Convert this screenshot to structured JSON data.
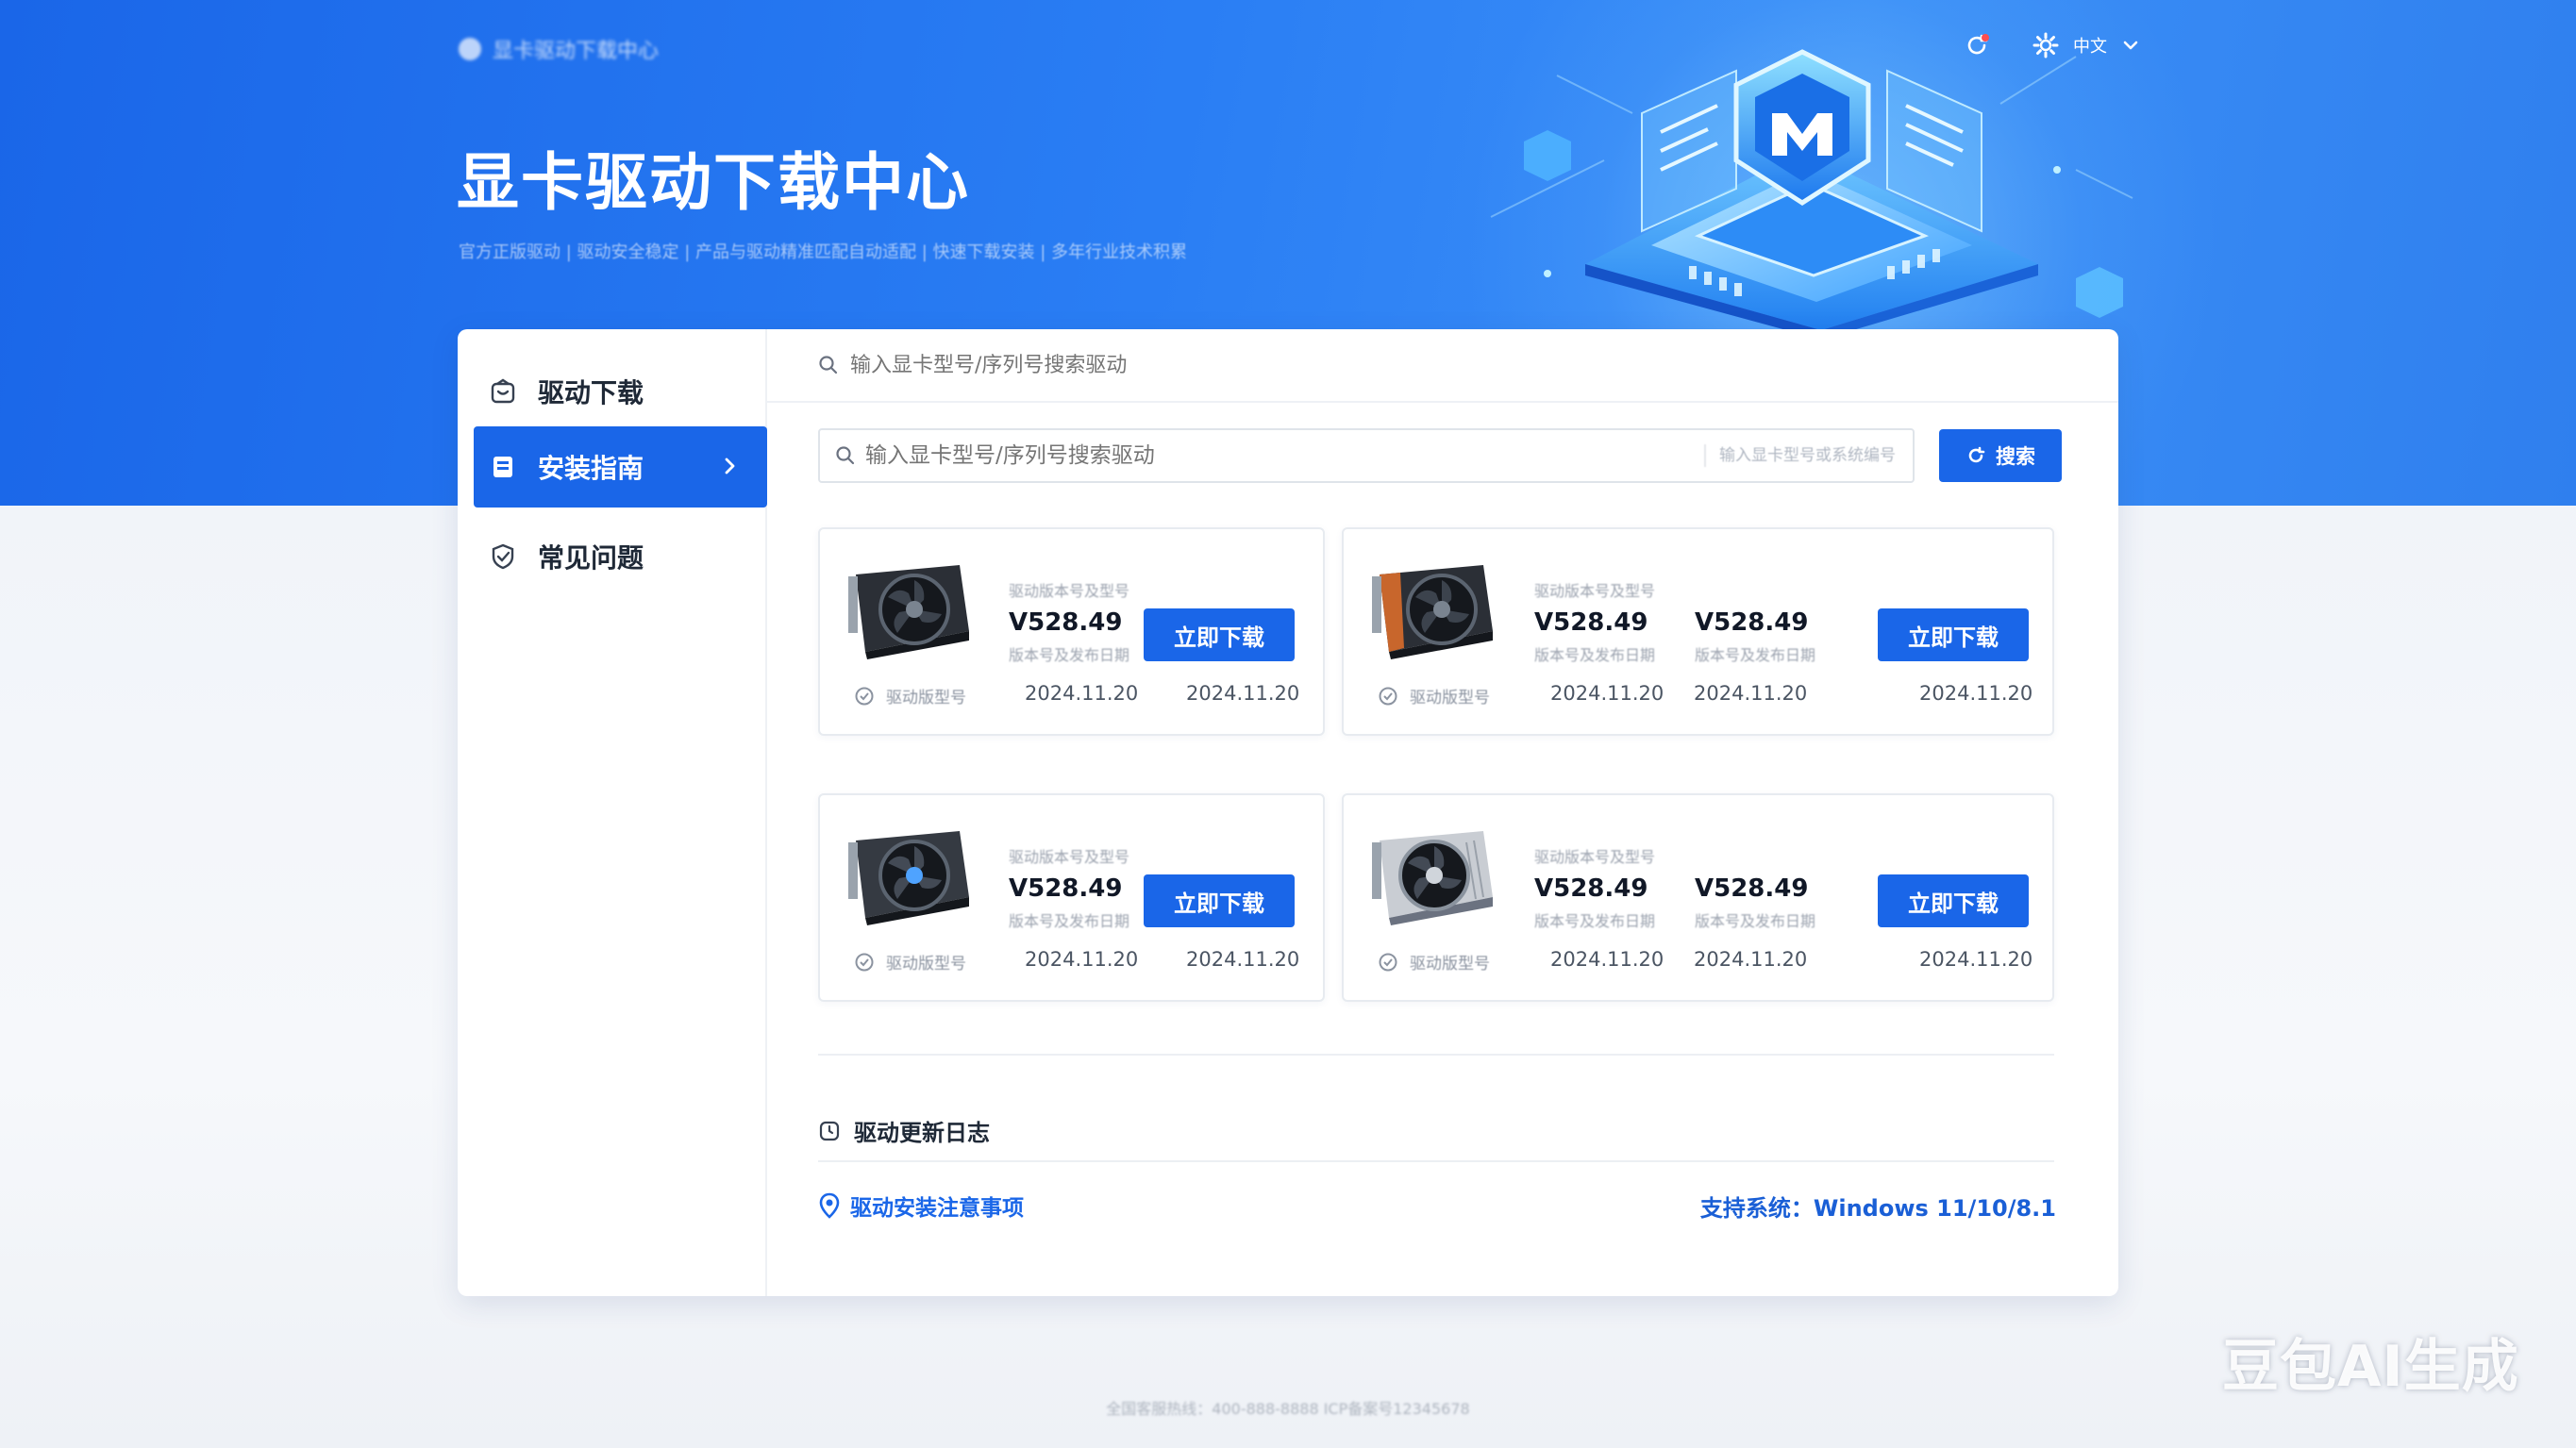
{
  "header": {
    "brand": "显卡驱动下载中心",
    "title": "显卡驱动下载中心",
    "subtitle": "官方正版驱动  |  驱动安全稳定  |  产品与驱动精准匹配自动适配  |  快速下载安装  |  多年行业技术积累",
    "language_label": "中文"
  },
  "sidebar": {
    "items": [
      {
        "label": "驱动下载",
        "icon": "box-icon"
      },
      {
        "label": "安装指南",
        "icon": "book-icon",
        "active": true
      },
      {
        "label": "常见问题",
        "icon": "shield-check-icon"
      }
    ]
  },
  "search": {
    "top_placeholder": "输入显卡型号/序列号搜索驱动",
    "main_placeholder": "输入显卡型号/序列号搜索驱动",
    "hint": "输入显卡型号或系统编号",
    "button_label": "搜索"
  },
  "cards": [
    {
      "label_top": "驱动版本号及型号",
      "version_1": "V528.49",
      "label_mid_1": "版本号及发布日期",
      "date_1": "2024.11.20",
      "date_2": "2024.11.20",
      "foot_label": "驱动版型号",
      "download_label": "立即下载"
    },
    {
      "label_top": "驱动版本号及型号",
      "version_1": "V528.49",
      "version_2": "V528.49",
      "label_mid_1": "版本号及发布日期",
      "label_mid_2": "版本号及发布日期",
      "date_1": "2024.11.20",
      "date_2": "2024.11.20",
      "date_3": "2024.11.20",
      "foot_label": "驱动版型号",
      "download_label": "立即下载"
    },
    {
      "label_top": "驱动版本号及型号",
      "version_1": "V528.49",
      "label_mid_1": "版本号及发布日期",
      "date_1": "2024.11.20",
      "date_2": "2024.11.20",
      "foot_label": "驱动版型号",
      "download_label": "立即下载"
    },
    {
      "label_top": "驱动版本号及型号",
      "version_1": "V528.49",
      "version_2": "V528.49",
      "label_mid_1": "版本号及发布日期",
      "label_mid_2": "版本号及发布日期",
      "date_1": "2024.11.20",
      "date_2": "2024.11.20",
      "date_3": "2024.11.20",
      "foot_label": "驱动版型号",
      "download_label": "立即下载"
    }
  ],
  "footer_section": {
    "log_title": "驱动更新日志",
    "install_note": "驱动安装注意事项",
    "os_support": "支持系统：Windows 11/10/8.1"
  },
  "page_footer": "全国客服热线：400-888-8888  ICP备案号12345678",
  "watermark": "豆包AI生成",
  "colors": {
    "primary": "#1a66e8",
    "hero_start": "#1a66e8",
    "hero_end": "#3b8ff7",
    "text_dark": "#1f2937",
    "muted": "#9ca3af"
  }
}
